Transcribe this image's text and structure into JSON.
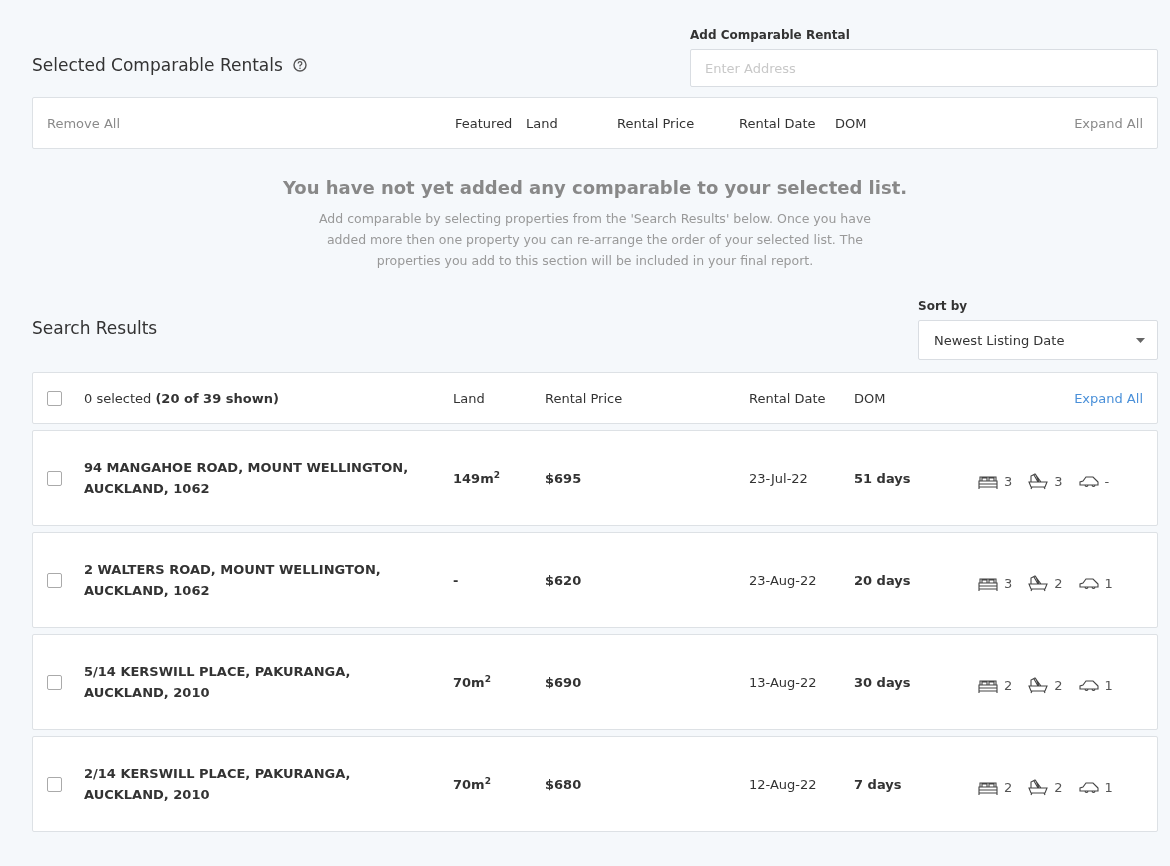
{
  "selected_section": {
    "title": "Selected Comparable Rentals",
    "add_field": {
      "label": "Add Comparable Rental",
      "placeholder": "Enter Address"
    },
    "header": {
      "remove_all": "Remove All",
      "columns": [
        "Featured",
        "Land",
        "Rental Price",
        "Rental Date",
        "DOM"
      ],
      "expand_all": "Expand All"
    },
    "empty_title": "You have not yet added any comparable to your selected list.",
    "empty_text": "Add comparable by selecting properties from the 'Search Results' below. Once you have added more then one property you can re-arrange the order of your selected list. The properties you add to this section will be included in your final report."
  },
  "search_results": {
    "title": "Search Results",
    "sort": {
      "label": "Sort by",
      "value": "Newest Listing Date"
    },
    "header": {
      "checked": false,
      "summary": "0 selected **(20 of 39 shown)**",
      "columns": [
        "Land",
        "Rental Price",
        "Rental Date",
        "DOM"
      ],
      "expand_all": "Expand All"
    },
    "rows": [
      {
        "checked": false,
        "address": "94 MANGAHOE ROAD, MOUNT WELLINGTON, AUCKLAND, 1062",
        "land": "149m$^{2}$",
        "price": "$695",
        "date": "23-Jul-22",
        "dom": "51 days",
        "beds": "3",
        "baths": "3",
        "cars": "-"
      },
      {
        "checked": false,
        "address": "2 WALTERS ROAD, MOUNT WELLINGTON, AUCKLAND, 1062",
        "land": "-",
        "price": "$620",
        "date": "23-Aug-22",
        "dom": "20 days",
        "beds": "3",
        "baths": "2",
        "cars": "1"
      },
      {
        "checked": false,
        "address": "5/14 KERSWILL PLACE, PAKURANGA, AUCKLAND, 2010",
        "land": "70m$^{2}$",
        "price": "$690",
        "date": "13-Aug-22",
        "dom": "30 days",
        "beds": "2",
        "baths": "2",
        "cars": "1"
      },
      {
        "checked": false,
        "address": "2/14 KERSWILL PLACE, PAKURANGA, AUCKLAND, 2010",
        "land": "70m$^{2}$",
        "price": "$680",
        "date": "12-Aug-22",
        "dom": "7 days",
        "beds": "2",
        "baths": "2",
        "cars": "1"
      }
    ]
  }
}
